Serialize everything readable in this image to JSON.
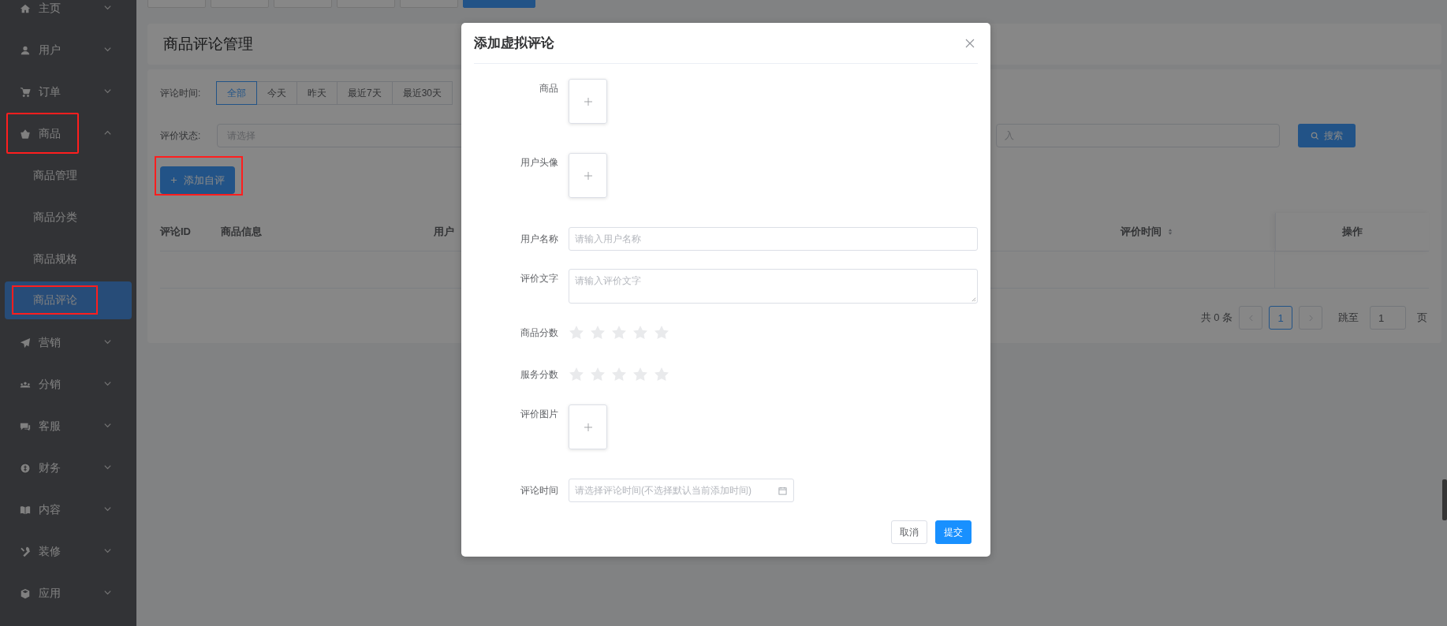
{
  "page_tabs": [
    {
      "selected": false
    },
    {
      "selected": false
    },
    {
      "selected": false
    },
    {
      "selected": false
    },
    {
      "selected": false
    },
    {
      "selected": true
    }
  ],
  "sidebar": {
    "items": [
      {
        "label": "主页",
        "expanded": false,
        "annotated": false
      },
      {
        "label": "用户",
        "expanded": false,
        "annotated": false
      },
      {
        "label": "订单",
        "expanded": false,
        "annotated": false
      },
      {
        "label": "商品",
        "expanded": true,
        "annotated": true,
        "children": [
          {
            "label": "商品管理",
            "selected": false,
            "annotated": false
          },
          {
            "label": "商品分类",
            "selected": false,
            "annotated": false
          },
          {
            "label": "商品规格",
            "selected": false,
            "annotated": false
          },
          {
            "label": "商品评论",
            "selected": true,
            "annotated": true
          }
        ]
      },
      {
        "label": "营销",
        "expanded": false,
        "annotated": false
      },
      {
        "label": "分销",
        "expanded": false,
        "annotated": false
      },
      {
        "label": "客服",
        "expanded": false,
        "annotated": false
      },
      {
        "label": "财务",
        "expanded": false,
        "annotated": false
      },
      {
        "label": "内容",
        "expanded": false,
        "annotated": false
      },
      {
        "label": "装修",
        "expanded": false,
        "annotated": false
      },
      {
        "label": "应用",
        "expanded": false,
        "annotated": false
      }
    ]
  },
  "page_title": "商品评论管理",
  "filters": {
    "time_label": "评论时间:",
    "time_options": [
      {
        "label": "全部",
        "selected": true
      },
      {
        "label": "今天",
        "selected": false
      },
      {
        "label": "昨天",
        "selected": false
      },
      {
        "label": "最近7天",
        "selected": false
      },
      {
        "label": "最近30天",
        "selected": false
      }
    ],
    "status_label": "评价状态:",
    "status_placeholder": "请选择",
    "keyword_placeholder": "入",
    "search_button": "搜索"
  },
  "add_button": {
    "label": "添加自评",
    "annotated": true
  },
  "table": {
    "columns": [
      {
        "label": "评论ID",
        "sortable": false
      },
      {
        "label": "商品信息",
        "sortable": false
      },
      {
        "label": "用户",
        "sortable": false
      },
      {
        "label": "评价时间",
        "sortable": true
      },
      {
        "label": "操作",
        "sortable": false
      }
    ]
  },
  "pagination": {
    "total": "共 0 条",
    "pages": [
      {
        "label": "1",
        "selected": true
      }
    ],
    "jump_label": "跳至",
    "jump_value": "1",
    "page_suffix": "页"
  },
  "dialog": {
    "title": "添加虚拟评论",
    "fields": [
      {
        "kind": "upload",
        "label": "商品"
      },
      {
        "kind": "upload",
        "label": "用户头像"
      },
      {
        "kind": "input",
        "label": "用户名称",
        "placeholder": "请输入用户名称"
      },
      {
        "kind": "textarea",
        "label": "评价文字",
        "placeholder": "请输入评价文字"
      },
      {
        "kind": "rating",
        "label": "商品分数",
        "stars": 0
      },
      {
        "kind": "rating",
        "label": "服务分数",
        "stars": 0
      },
      {
        "kind": "upload",
        "label": "评价图片"
      },
      {
        "kind": "date",
        "label": "评论时间",
        "placeholder": "请选择评论时间(不选择默认当前添加时间)"
      }
    ],
    "buttons": [
      {
        "label": "取消",
        "primary": false
      },
      {
        "label": "提交",
        "primary": true
      }
    ]
  }
}
